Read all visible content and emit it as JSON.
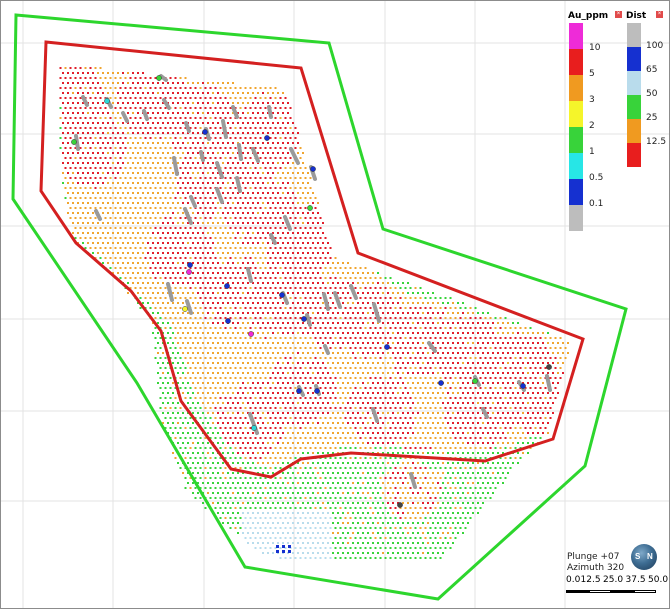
{
  "colors": {
    "background": "#ffffff",
    "grid": "#e3e3e3",
    "outer_boundary": "#2dd62d",
    "inner_boundary": "#d42020",
    "drillhole": "#9a9a9a"
  },
  "legend_au": {
    "title": "Au_ppm",
    "close_icon": "close-icon",
    "items": [
      {
        "label": "10",
        "color": "#ee2bd8"
      },
      {
        "label": "5",
        "color": "#e81e1e"
      },
      {
        "label": "3",
        "color": "#f09a20"
      },
      {
        "label": "2",
        "color": "#f5f52a"
      },
      {
        "label": "1",
        "color": "#38d33a"
      },
      {
        "label": "0.5",
        "color": "#27e6e6"
      },
      {
        "label": "0.1",
        "color": "#1530d0"
      },
      {
        "label": "",
        "color": "#bdbdbd"
      }
    ]
  },
  "legend_dist": {
    "title": "Dist",
    "close_icon": "close-icon",
    "items": [
      {
        "label": "100",
        "color": "#bdbdbd"
      },
      {
        "label": "65",
        "color": "#1530d0"
      },
      {
        "label": "50",
        "color": "#b9dcec"
      },
      {
        "label": "25",
        "color": "#38d33a"
      },
      {
        "label": "12.5",
        "color": "#f09a20"
      },
      {
        "label": "",
        "color": "#e81e1e"
      }
    ]
  },
  "view": {
    "plunge": "Plunge +07",
    "azimuth": "Azimuth 320",
    "compass_icon": "compass-icon",
    "compass_s": "S",
    "compass_n": "N"
  },
  "scale_bar": {
    "ticks": [
      "0.0",
      "12.5",
      "25.0",
      "37.5",
      "50.0"
    ]
  }
}
